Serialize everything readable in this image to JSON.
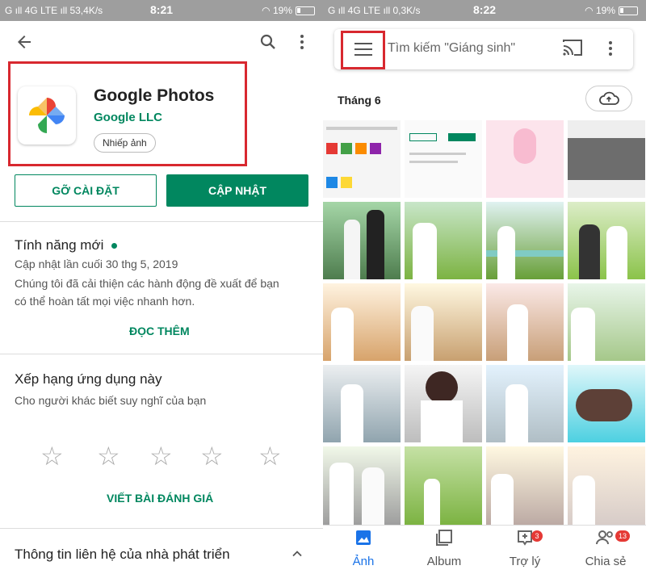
{
  "left": {
    "status": {
      "carrier": "G ıll 4G LTE ıll 53,4K/s",
      "time": "8:21",
      "battery": "19%"
    },
    "app": {
      "title": "Google Photos",
      "developer": "Google LLC",
      "category": "Nhiếp ảnh"
    },
    "buttons": {
      "uninstall": "GỠ CÀI ĐẶT",
      "update": "CẬP NHẬT"
    },
    "whats_new": {
      "title": "Tính năng mới",
      "updated": "Cập nhật lần cuối 30 thg 5, 2019",
      "body_line1": "Chúng tôi đã cải thiện các hành động đề xuất để bạn",
      "body_line2": "có thể hoàn tất mọi việc nhanh hơn.",
      "read_more": "ĐỌC THÊM"
    },
    "rate": {
      "title": "Xếp hạng ứng dụng này",
      "subtitle": "Cho người khác biết suy nghĩ của bạn",
      "write_review": "VIẾT BÀI ĐÁNH GIÁ",
      "star_glyph": "☆"
    },
    "developer_contact": "Thông tin liên hệ của nhà phát triển"
  },
  "right": {
    "status": {
      "carrier": "G ıll 4G LTE ıll 0,3K/s",
      "time": "8:22",
      "battery": "19%"
    },
    "search_placeholder": "Tìm kiếm \"Giáng sinh\"",
    "month_label": "Tháng 6",
    "nav": {
      "photos": "Ảnh",
      "albums": "Album",
      "assistant": "Trợ lý",
      "assistant_badge": "3",
      "sharing": "Chia sẻ",
      "sharing_badge": "13"
    }
  },
  "colors": {
    "accent_green": "#01875f",
    "highlight_red": "#d8282f",
    "active_blue": "#1a73e8"
  }
}
